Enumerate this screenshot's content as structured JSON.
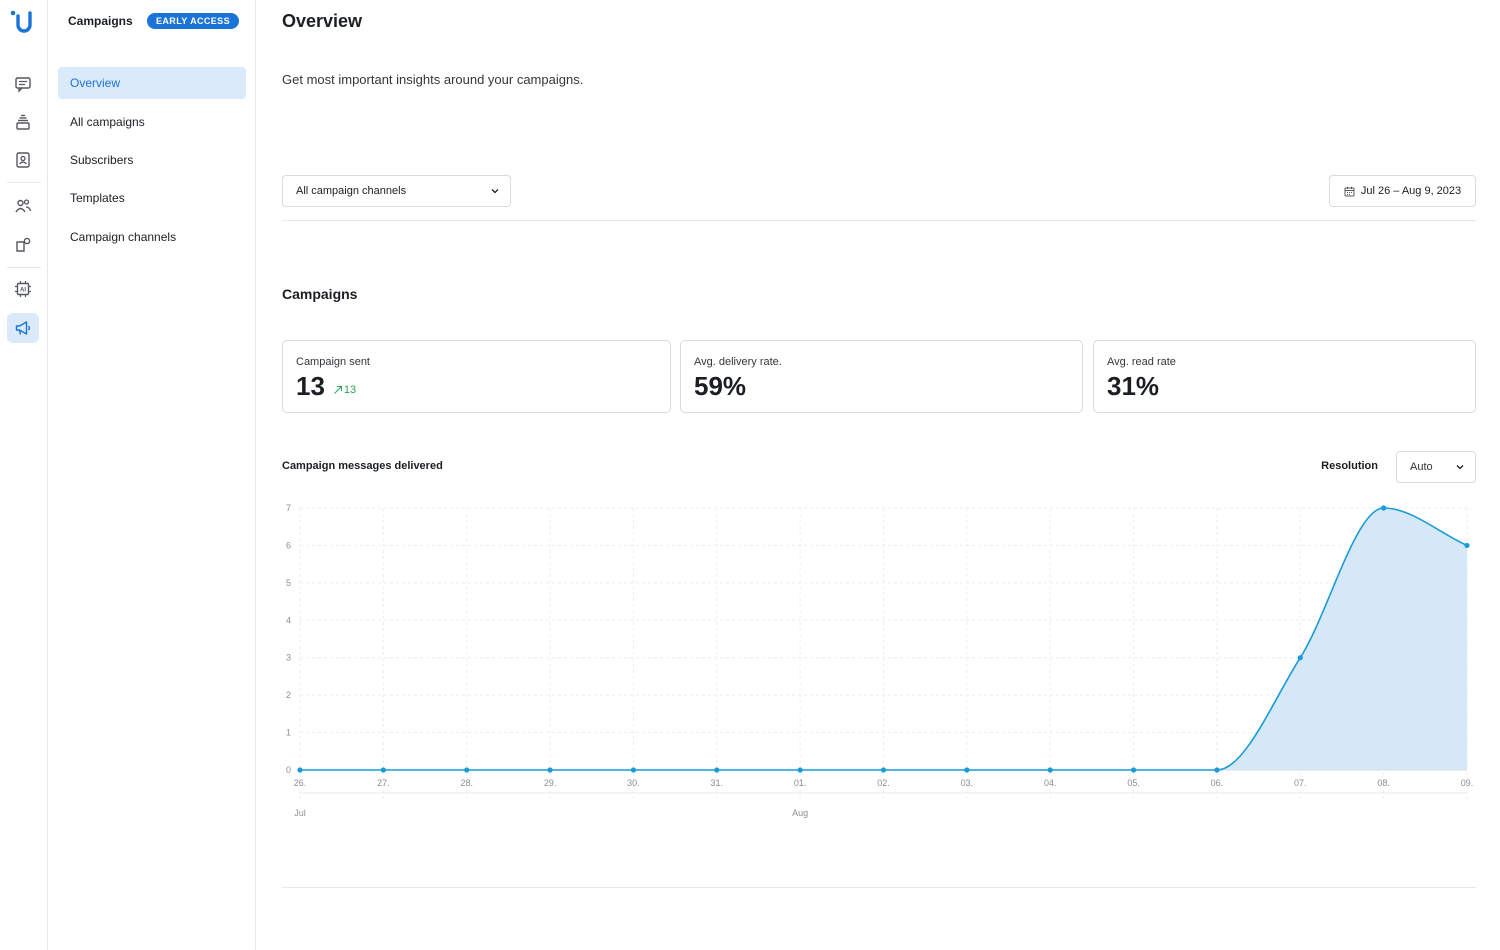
{
  "rail": {
    "icons": [
      "chat-icon",
      "inbox-stack-icon",
      "contacts-icon",
      "team-icon",
      "integrations-icon",
      "ai-chip-icon",
      "megaphone-icon"
    ],
    "accent": "#1a73d9"
  },
  "sidebar": {
    "title": "Campaigns",
    "badge": "EARLY ACCESS",
    "items": [
      {
        "label": "Overview",
        "active": true
      },
      {
        "label": "All campaigns",
        "active": false
      },
      {
        "label": "Subscribers",
        "active": false
      },
      {
        "label": "Templates",
        "active": false
      },
      {
        "label": "Campaign channels",
        "active": false
      }
    ]
  },
  "header": {
    "title": "Overview",
    "subtitle": "Get most important insights around your campaigns."
  },
  "filters": {
    "channel": "All campaign channels",
    "date_range": "Jul 26 – Aug 9, 2023"
  },
  "campaigns": {
    "title": "Campaigns",
    "stats": [
      {
        "label": "Campaign sent",
        "value": "13",
        "trend": "13"
      },
      {
        "label": "Avg. delivery rate.",
        "value": "59%",
        "trend": ""
      },
      {
        "label": "Avg. read rate",
        "value": "31%",
        "trend": ""
      }
    ]
  },
  "chart_section": {
    "title": "Campaign messages delivered",
    "resolution_label": "Resolution",
    "resolution_value": "Auto"
  },
  "chart_data": {
    "type": "area",
    "title": "Campaign messages delivered",
    "x": [
      "26.",
      "27.",
      "28.",
      "29.",
      "30.",
      "31.",
      "01.",
      "02.",
      "03.",
      "04.",
      "05.",
      "06.",
      "07.",
      "08.",
      "09."
    ],
    "month_labels": [
      {
        "at": "26.",
        "label": "Jul"
      },
      {
        "at": "01.",
        "label": "Aug"
      }
    ],
    "series": [
      {
        "values": [
          0,
          0,
          0,
          0,
          0,
          0,
          0,
          0,
          0,
          0,
          0,
          0,
          3,
          7,
          6
        ]
      }
    ],
    "ylim": [
      0,
      7
    ],
    "yticks": [
      0,
      1,
      2,
      3,
      4,
      5,
      6,
      7
    ],
    "grid": true,
    "colors": {
      "line": "#1a9bd7",
      "fill": "#cfe6f7"
    }
  }
}
